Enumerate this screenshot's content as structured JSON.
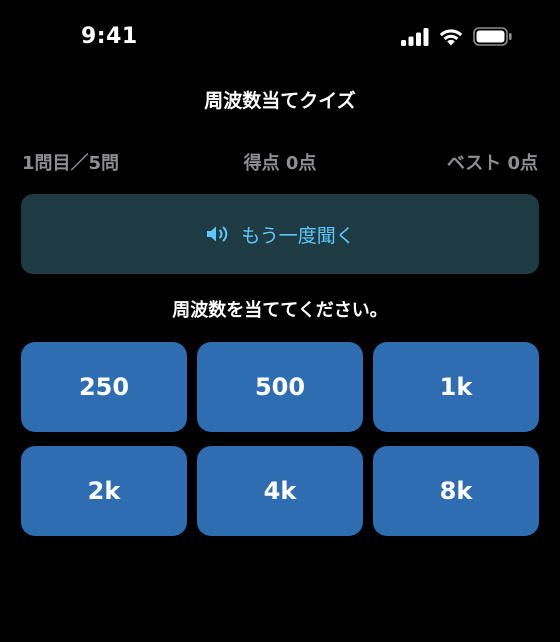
{
  "status_bar": {
    "time": "9:41",
    "icons": [
      "cellular-signal-icon",
      "wifi-icon",
      "battery-icon"
    ]
  },
  "nav": {
    "title": "周波数当てクイズ"
  },
  "stats": {
    "progress": "1問目／5問",
    "score": "得点 0点",
    "best": "ベスト 0点"
  },
  "replay": {
    "icon": "speaker-icon",
    "label": "もう一度聞く"
  },
  "prompt": "周波数を当ててください。",
  "answers": [
    "250",
    "500",
    "1k",
    "2k",
    "4k",
    "8k"
  ],
  "colors": {
    "background": "#000000",
    "stats_text": "#8e8e93",
    "replay_background": "#1e3a43",
    "accent": "#5ac8fa",
    "answer_button": "#2f6db3"
  }
}
